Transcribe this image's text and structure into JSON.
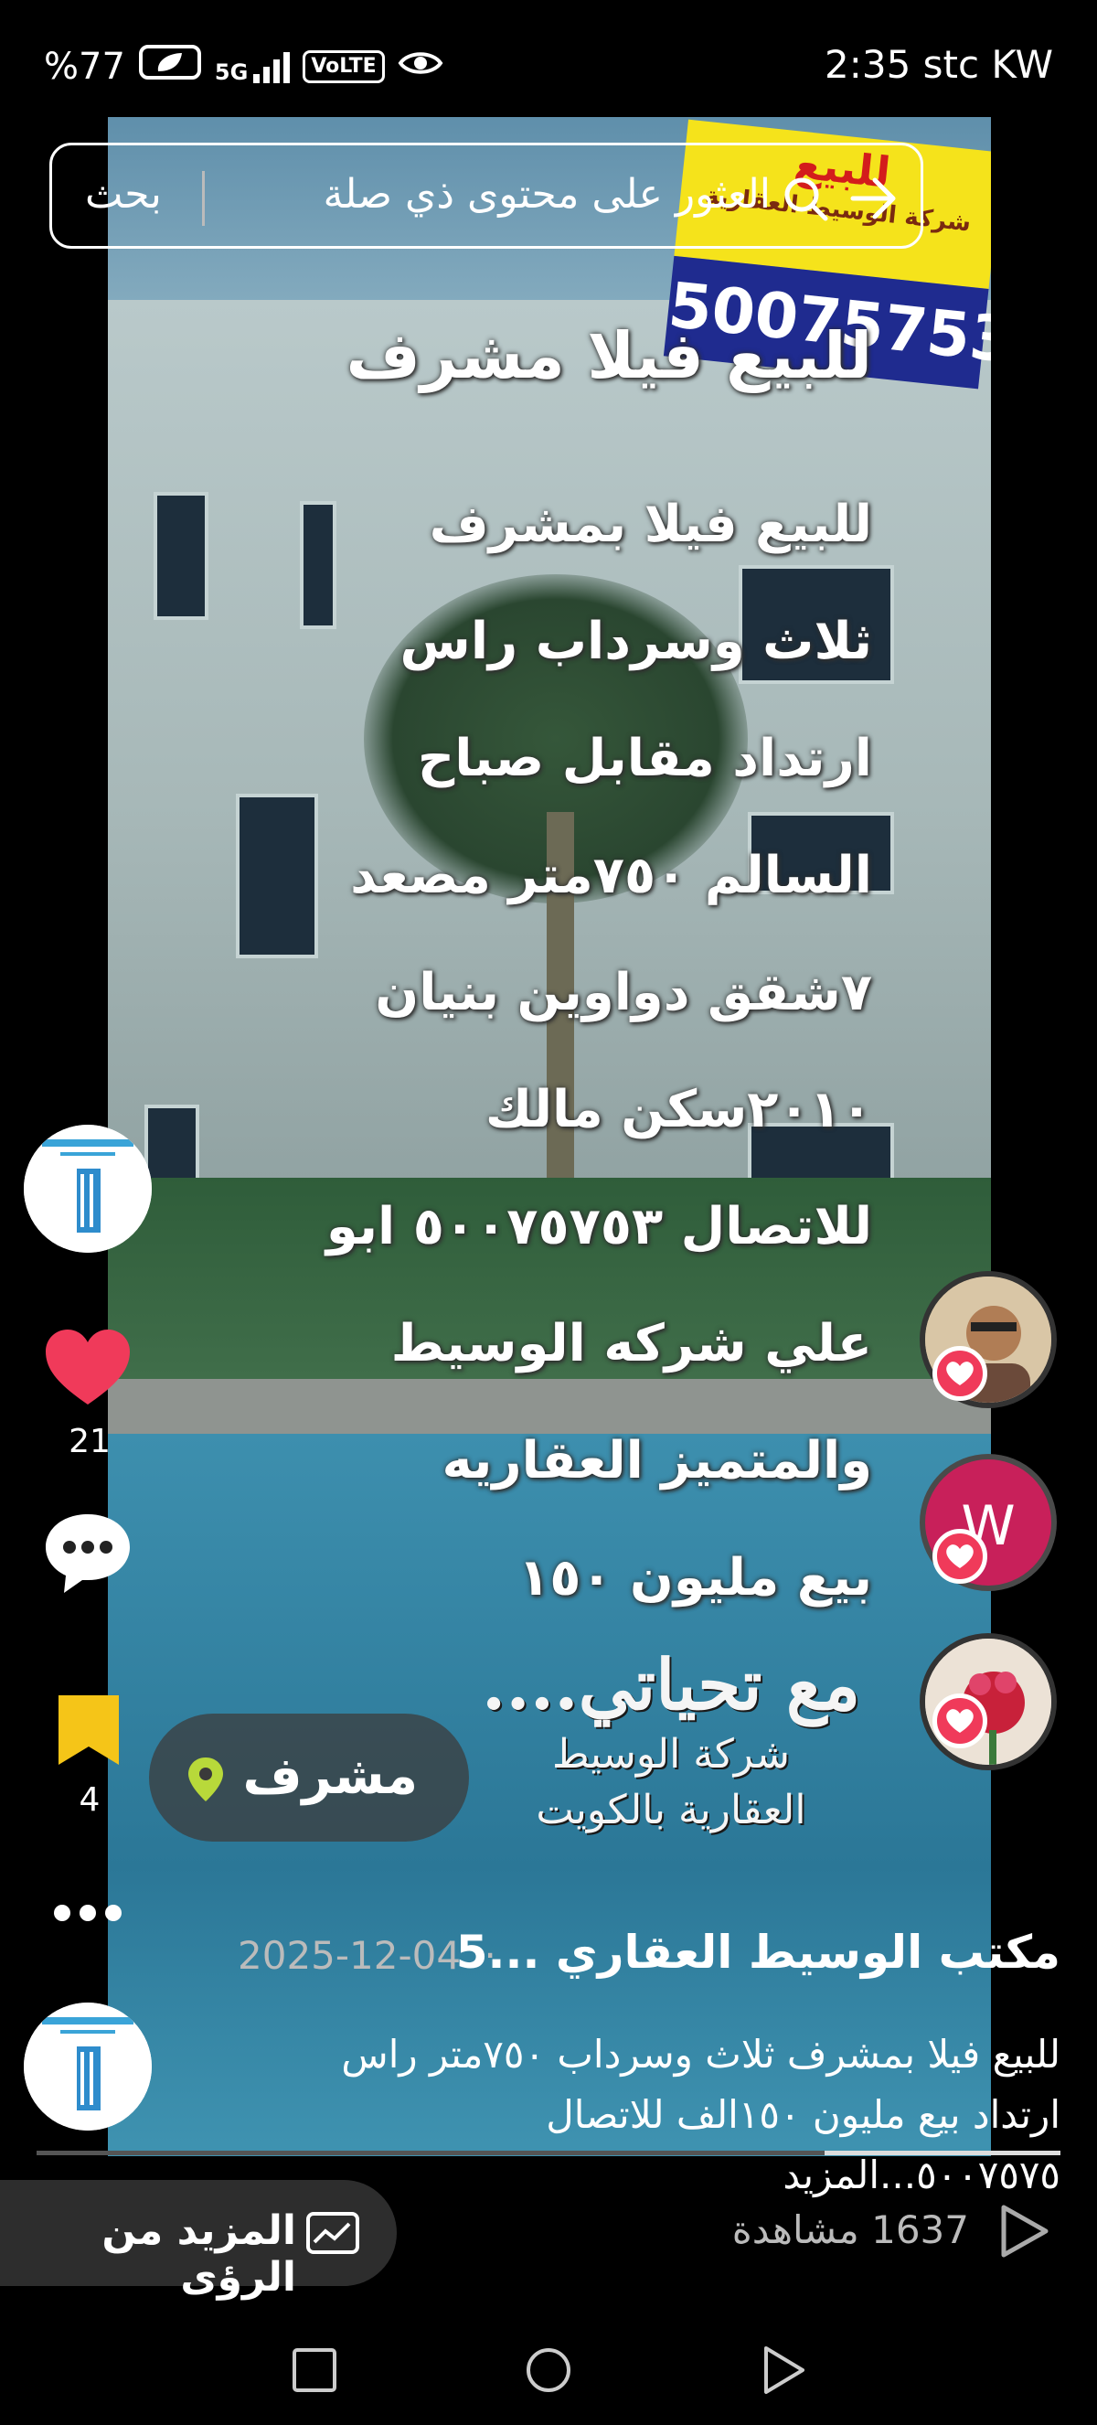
{
  "status_bar": {
    "battery": "%77",
    "network": "5G",
    "volte": "VoLTE",
    "time_carrier": "2:35 stc KW"
  },
  "search": {
    "placeholder": "العثور على محتوى ذي صلة",
    "button_label": "بحث"
  },
  "video": {
    "sign_top": "للبيع",
    "sign_sub": "شركة الوسيط العقارية",
    "sign_phone": "50075753",
    "title": "للبيع فيلا مشرف",
    "lines": [
      "للبيع فيلا بمشرف",
      "ثلاث وسرداب راس",
      "ارتداد مقابل صباح",
      "السالم ٧٥٠متر مصعد",
      "٧شقق دواوين بنيان",
      "٢٠١٠سكن مالك",
      "للاتصال ٥٠٠٧٥٧٥٣ ابو",
      "علي شركه الوسيط",
      "والمتميز العقاريه",
      "بيع مليون ١٥٠"
    ],
    "watermark_line1": "مع تحياتي....",
    "watermark_line2": "شركة الوسيط",
    "watermark_line3": "العقارية بالكويت"
  },
  "location_chip": {
    "label": "مشرف"
  },
  "actions": {
    "likes": "21",
    "saves": "4"
  },
  "info": {
    "author": "مكتب الوسيط العقاري ...5",
    "date": "2025-12-04",
    "separator": "·",
    "desc_line1": "للبيع فيلا بمشرف ثلاث وسرداب ٧٥٠متر راس",
    "desc_line2": "ارتداد بيع مليون ١٥٠الف للاتصال ٥٠٠٧٥٧٥...المزيد"
  },
  "progress": 0.23,
  "insights_button": {
    "label": "المزيد من الرؤى"
  },
  "views": {
    "label": "1637 مشاهدة"
  },
  "colors": {
    "like_red": "#f03a5a",
    "save_yellow": "#f5c518"
  }
}
